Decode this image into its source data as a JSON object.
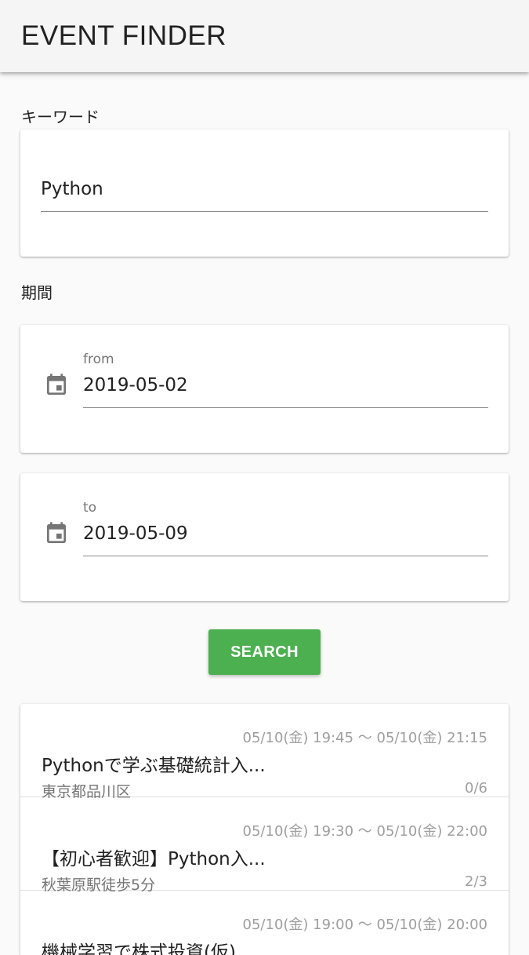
{
  "app": {
    "title": "EVENT FINDER"
  },
  "keyword": {
    "label": "キーワード",
    "value": "Python"
  },
  "period": {
    "label": "期間",
    "from": {
      "caption": "from",
      "value": "2019-05-02",
      "icon": "calendar-icon"
    },
    "to": {
      "caption": "to",
      "value": "2019-05-09",
      "icon": "calendar-icon"
    }
  },
  "search_button": {
    "label": "SEARCH",
    "color": "#4caf50"
  },
  "results": [
    {
      "datetime": "05/10(金) 19:45 〜 05/10(金) 21:15",
      "title": "Pythonで学ぶ基礎統計入...",
      "place": "東京都品川区",
      "count": "0/6"
    },
    {
      "datetime": "05/10(金) 19:30 〜 05/10(金) 22:00",
      "title": "【初心者歓迎】Python入...",
      "place": "秋葉原駅徒歩5分",
      "count": "2/3"
    },
    {
      "datetime": "05/10(金) 19:00 〜 05/10(金) 20:00",
      "title": "機械学習で株式投資(仮)",
      "place": "",
      "count": ""
    }
  ]
}
